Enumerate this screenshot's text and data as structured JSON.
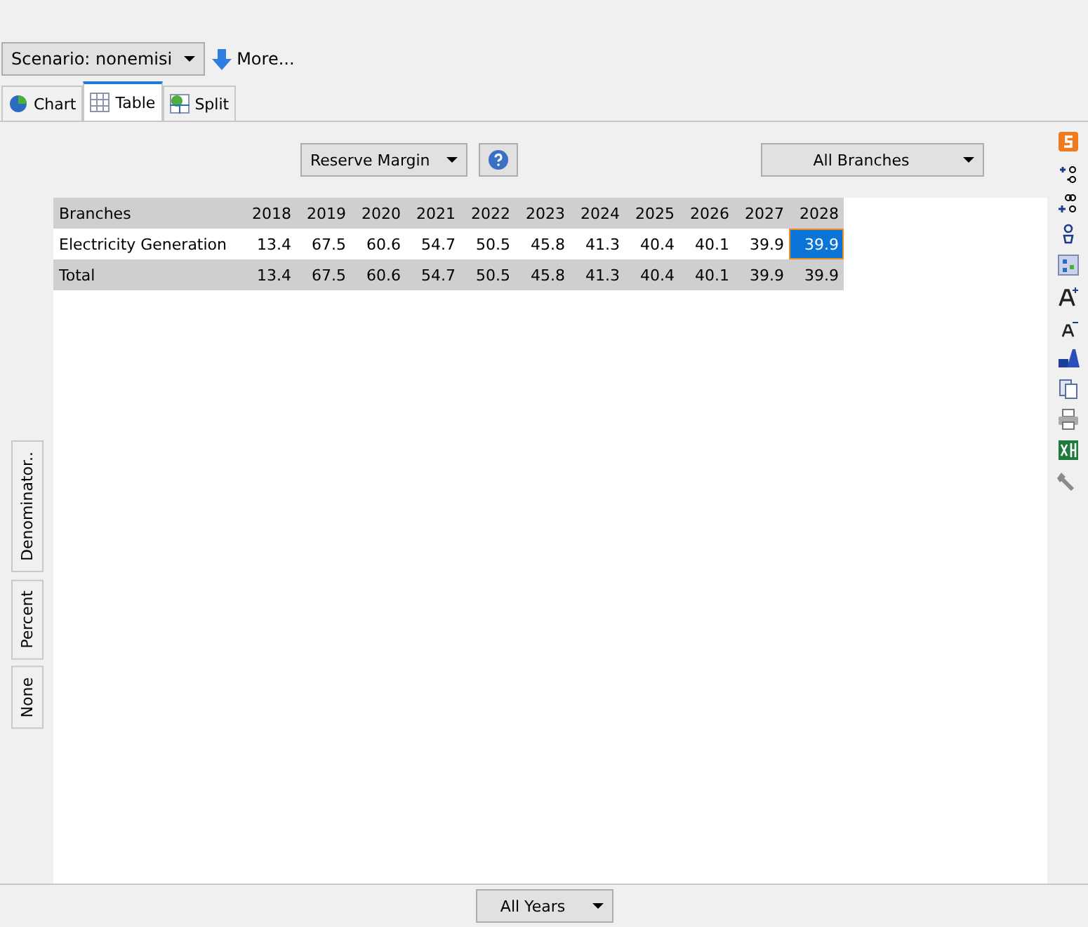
{
  "scenario": {
    "label": "Scenario: nonemisi"
  },
  "more": {
    "label": "More..."
  },
  "tabs": [
    {
      "label": "Chart",
      "kind": "chart",
      "selected": false
    },
    {
      "label": "Table",
      "kind": "table",
      "selected": true
    },
    {
      "label": "Split",
      "kind": "split",
      "selected": false
    }
  ],
  "variable": {
    "label": "Reserve Margin"
  },
  "branches": {
    "label": "All Branches"
  },
  "side_tabs": [
    {
      "label": "Denominator..",
      "selected": false
    },
    {
      "label": "Percent",
      "selected": false
    },
    {
      "label": "None",
      "selected": false
    }
  ],
  "table": {
    "columns": [
      "Branches",
      "2018",
      "2019",
      "2020",
      "2021",
      "2022",
      "2023",
      "2024",
      "2025",
      "2026",
      "2027",
      "2028"
    ],
    "rows": [
      {
        "kind": "data",
        "cells": [
          {
            "value": "Electricity Generation",
            "selected": false
          },
          {
            "value": "13.4",
            "selected": false
          },
          {
            "value": "67.5",
            "selected": false
          },
          {
            "value": "60.6",
            "selected": false
          },
          {
            "value": "54.7",
            "selected": false
          },
          {
            "value": "50.5",
            "selected": false
          },
          {
            "value": "45.8",
            "selected": false
          },
          {
            "value": "41.3",
            "selected": false
          },
          {
            "value": "40.4",
            "selected": false
          },
          {
            "value": "40.1",
            "selected": false
          },
          {
            "value": "39.9",
            "selected": false
          },
          {
            "value": "39.9",
            "selected": true
          }
        ]
      },
      {
        "kind": "total",
        "cells": [
          {
            "value": "Total",
            "selected": false
          },
          {
            "value": "13.4",
            "selected": false
          },
          {
            "value": "67.5",
            "selected": false
          },
          {
            "value": "60.6",
            "selected": false
          },
          {
            "value": "54.7",
            "selected": false
          },
          {
            "value": "50.5",
            "selected": false
          },
          {
            "value": "45.8",
            "selected": false
          },
          {
            "value": "41.3",
            "selected": false
          },
          {
            "value": "40.4",
            "selected": false
          },
          {
            "value": "40.1",
            "selected": false
          },
          {
            "value": "39.9",
            "selected": false
          },
          {
            "value": "39.9",
            "selected": false
          }
        ]
      }
    ]
  },
  "years": {
    "label": "All Years"
  }
}
